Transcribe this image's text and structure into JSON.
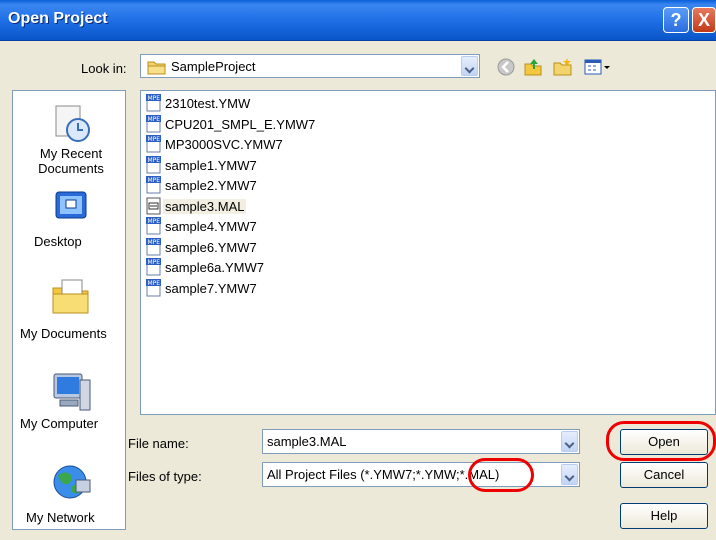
{
  "window": {
    "title": "Open Project"
  },
  "look_in": {
    "label": "Look in:",
    "value": "SampleProject"
  },
  "places": [
    {
      "label": "My Recent Documents",
      "icon": "recent-documents-icon"
    },
    {
      "label": "Desktop",
      "icon": "desktop-icon"
    },
    {
      "label": "My Documents",
      "icon": "my-documents-icon"
    },
    {
      "label": "My Computer",
      "icon": "my-computer-icon"
    },
    {
      "label": "My Network",
      "icon": "my-network-icon"
    }
  ],
  "files": [
    {
      "name": "2310test.YMW",
      "icon": "mpe-file-icon"
    },
    {
      "name": "CPU201_SMPL_E.YMW7",
      "icon": "mpe-file-icon"
    },
    {
      "name": "MP3000SVC.YMW7",
      "icon": "mpe-file-icon"
    },
    {
      "name": "sample1.YMW7",
      "icon": "mpe-file-icon"
    },
    {
      "name": "sample2.YMW7",
      "icon": "mpe-file-icon"
    },
    {
      "name": "sample3.MAL",
      "icon": "mal-file-icon"
    },
    {
      "name": "sample4.YMW7",
      "icon": "mpe-file-icon"
    },
    {
      "name": "sample6.YMW7",
      "icon": "mpe-file-icon"
    },
    {
      "name": "sample6a.YMW7",
      "icon": "mpe-file-icon"
    },
    {
      "name": "sample7.YMW7",
      "icon": "mpe-file-icon"
    }
  ],
  "file_name": {
    "label": "File name:",
    "value": "sample3.MAL"
  },
  "file_type": {
    "label": "Files of type:",
    "value": "All Project Files (*.YMW7;*.YMW;*.MAL)"
  },
  "buttons": {
    "open": "Open",
    "cancel": "Cancel",
    "help": "Help"
  },
  "title_buttons": {
    "help": "?",
    "close": "X"
  }
}
